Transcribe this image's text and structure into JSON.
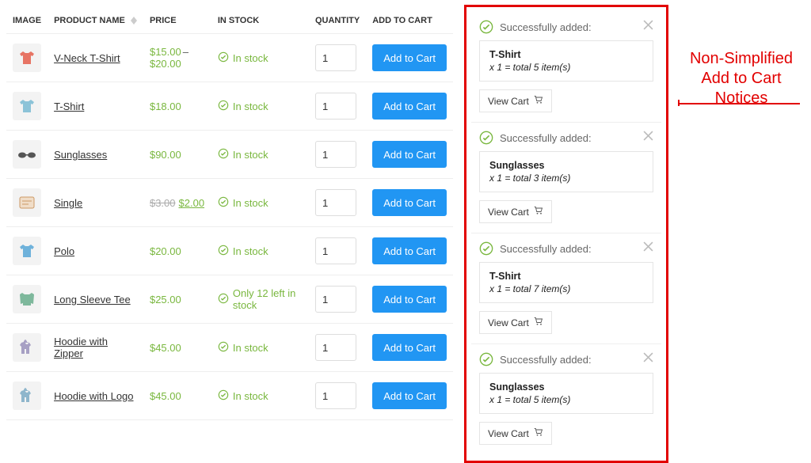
{
  "columns": {
    "image": "IMAGE",
    "name": "PRODUCT NAME",
    "price": "PRICE",
    "stock": "IN STOCK",
    "qty": "QUANTITY",
    "cart": "ADD TO CART"
  },
  "add_to_cart_label": "Add to Cart",
  "in_stock_label": "In stock",
  "products": [
    {
      "name": "V-Neck T-Shirt",
      "price_low": "$15.00",
      "price_high": "$20.00",
      "stock_text": "In stock",
      "qty": "1",
      "icon": "tshirt",
      "color": "#e77464"
    },
    {
      "name": "T-Shirt",
      "price": "$18.00",
      "stock_text": "In stock",
      "qty": "1",
      "icon": "tshirt",
      "color": "#8cc3d8"
    },
    {
      "name": "Sunglasses",
      "price": "$90.00",
      "stock_text": "In stock",
      "qty": "1",
      "icon": "glasses",
      "color": "#555"
    },
    {
      "name": "Single",
      "old_price": "$3.00",
      "price": "$2.00",
      "stock_text": "In stock",
      "qty": "1",
      "icon": "single",
      "color": "#c96"
    },
    {
      "name": "Polo",
      "price": "$20.00",
      "stock_text": "In stock",
      "qty": "1",
      "icon": "tshirt",
      "color": "#6fb2db"
    },
    {
      "name": "Long Sleeve Tee",
      "price": "$25.00",
      "stock_text": "Only 12 left in stock",
      "qty": "1",
      "icon": "longsleeve",
      "color": "#7eb89c"
    },
    {
      "name": "Hoodie with Zipper",
      "price": "$45.00",
      "stock_text": "In stock",
      "qty": "1",
      "icon": "hoodie",
      "color": "#a7a0c4"
    },
    {
      "name": "Hoodie with Logo",
      "price": "$45.00",
      "stock_text": "In stock",
      "qty": "1",
      "icon": "hoodie",
      "color": "#8fb6cc"
    }
  ],
  "notice_success_label": "Successfully added:",
  "view_cart_label": "View Cart",
  "notices": [
    {
      "product": "T-Shirt",
      "summary": "x 1 = total 5 item(s)"
    },
    {
      "product": "Sunglasses",
      "summary": "x 1 = total 3 item(s)"
    },
    {
      "product": "T-Shirt",
      "summary": "x 1 = total 7 item(s)"
    },
    {
      "product": "Sunglasses",
      "summary": "x 1 = total 5 item(s)"
    }
  ],
  "annotation": "Non-Simplified Add to Cart Notices"
}
